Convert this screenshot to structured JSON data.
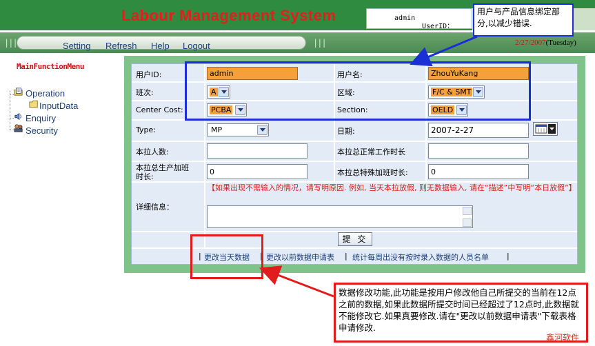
{
  "header": {
    "title": "Labour Management System",
    "user_id_label": "UserID：",
    "user_id_value": "admin"
  },
  "nav": {
    "items": [
      "Setting",
      "Refresh",
      "Help",
      "Logout"
    ],
    "date": "2/27/2007",
    "day": "(Tuesday)"
  },
  "sidebar": {
    "title": "MainFunctionMenu",
    "items": [
      {
        "label": "Operation",
        "icon": "folder-page-icon"
      },
      {
        "label": "InputData",
        "icon": "folder-icon"
      },
      {
        "label": "Enquiry",
        "icon": "speaker-icon"
      },
      {
        "label": "Security",
        "icon": "users-icon"
      }
    ]
  },
  "form": {
    "user_id_label": "用户ID:",
    "user_id_value": "admin",
    "user_name_label": "用户名:",
    "user_name_value": "ZhouYuKang",
    "shift_label": "班次:",
    "shift_value": "A",
    "area_label": "区域:",
    "area_value": "F/C & SMT",
    "cost_center_label": "Center Cost:",
    "cost_center_value": "PCBA",
    "section_label": "Section:",
    "section_value": "OELD",
    "type_label": "Type:",
    "type_value": "MP",
    "date_label": "日期:",
    "date_value": "2007-2-27",
    "headcount_label": "本拉人数:",
    "headcount_value": "",
    "normal_hours_label": "本拉总正常工作时长",
    "normal_hours_value": "",
    "overtime_label_1": "本拉总生产加班",
    "overtime_label_2": "时长:",
    "overtime_value": "0",
    "special_overtime_label": "本拉总特殊加班时长:",
    "special_overtime_value": "0",
    "detail_label": "详细信息：",
    "detail_note": "【如果出现不需输入的情况，请写明原因. 例如, 当天本拉放假, 则无数据输入, 请在“描述”中写明“本日放假”】",
    "detail_value": "",
    "submit_label": "提 交",
    "links": [
      "更改当天数据",
      "更改以前数据申请表",
      "统计每周出没有按时录入数据的人员名单"
    ]
  },
  "annotations": {
    "blue_note": "用户与产品信息绑定部分,以减少错误.",
    "red_note": "数据修改功能,此功能是按用户修改他自己所提交的当前在12点之前的数据,如果此数据所提交时间已经超过了12点时,此数据就不能修改它.如果真要修改.请在\"更改以前数据申请表\"下载表格申请修改.",
    "watermark": "鑫河软件"
  },
  "colors": {
    "header_green": "#2e8b3f",
    "title_red": "#e0201a",
    "panel_green": "#7fc38b",
    "form_bg": "#e3ebf6",
    "field_orange": "#f5a03a",
    "annotation_blue": "#1a2fd6",
    "annotation_red": "#e01c1c"
  }
}
